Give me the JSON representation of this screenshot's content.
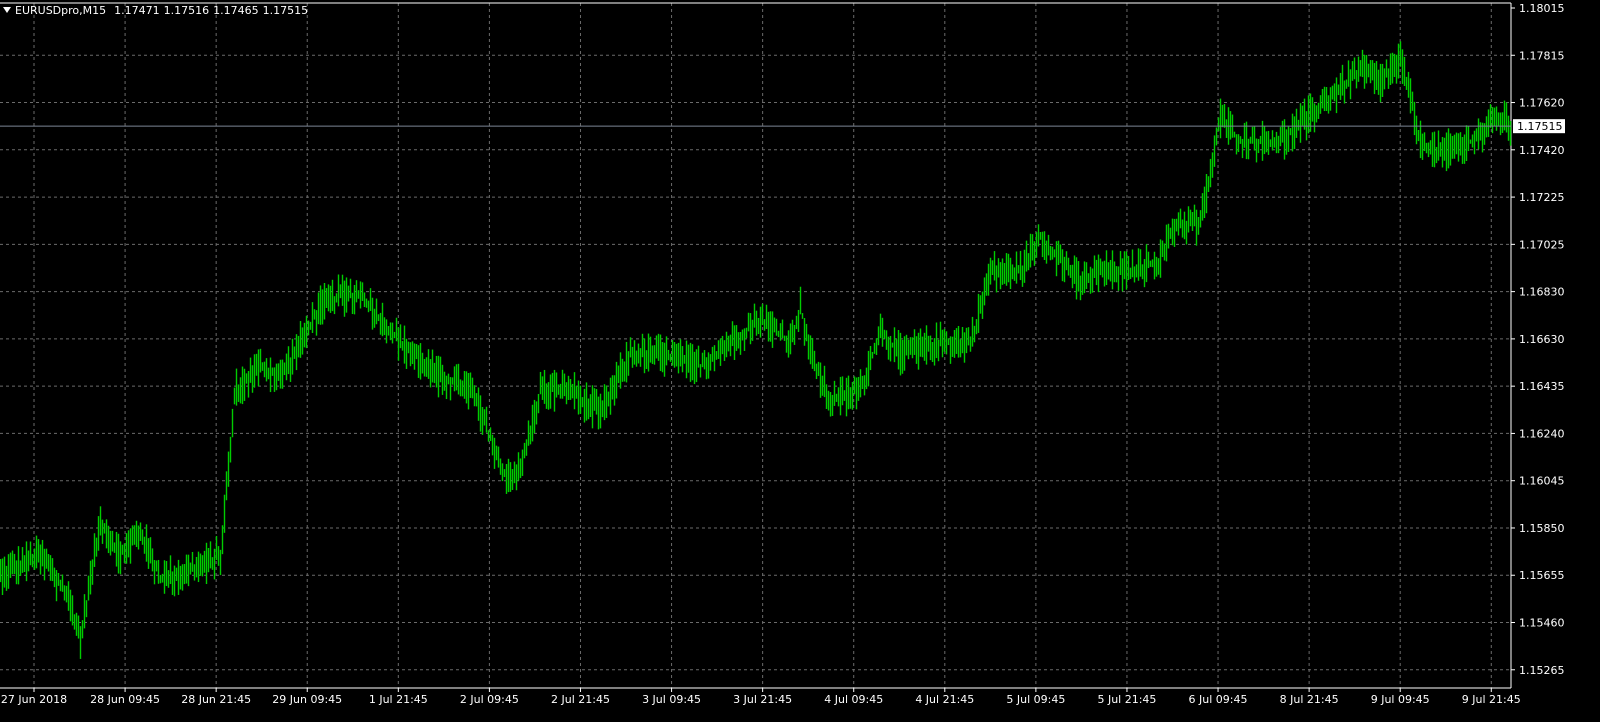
{
  "header": {
    "symbol": "EURUSDpro,M15",
    "open": "1.17471",
    "high": "1.17516",
    "low": "1.17465",
    "close": "1.17515"
  },
  "colors": {
    "background": "#000000",
    "candle": "#00cc00",
    "grid": "#6b6b6b",
    "axis_text": "#ffffff",
    "bid_line": "#7d8796"
  },
  "chart_data": {
    "type": "line",
    "title": "",
    "xlabel": "",
    "ylabel": "",
    "ylim": [
      1.1512,
      1.1802
    ],
    "yticks": [
      "1.18015",
      "1.17815",
      "1.17620",
      "1.17420",
      "1.17225",
      "1.17025",
      "1.16830",
      "1.16630",
      "1.16435",
      "1.16240",
      "1.16045",
      "1.15850",
      "1.15655",
      "1.15460",
      "1.15265"
    ],
    "xticks": [
      "27 Jun 2018",
      "28 Jun 09:45",
      "28 Jun 21:45",
      "29 Jun 09:45",
      "1 Jul 21:45",
      "2 Jul 09:45",
      "2 Jul 21:45",
      "3 Jul 09:45",
      "3 Jul 21:45",
      "4 Jul 09:45",
      "4 Jul 21:45",
      "5 Jul 09:45",
      "5 Jul 21:45",
      "6 Jul 09:45",
      "8 Jul 21:45",
      "9 Jul 09:45",
      "9 Jul 21:45"
    ],
    "current_price": "1.17515",
    "series": [
      {
        "x": [
          0,
          40,
          70,
          80,
          100,
          120,
          140,
          160,
          200,
          220,
          235,
          260,
          280,
          320,
          340,
          360,
          380,
          400,
          440,
          470,
          490,
          500,
          520,
          540,
          570,
          600,
          630,
          660,
          700,
          730,
          760,
          790,
          800,
          810,
          830,
          860,
          880,
          900,
          940,
          970,
          990,
          1020,
          1040,
          1060,
          1080,
          1100,
          1130,
          1160,
          1175,
          1200,
          1220,
          1240,
          1280,
          1320,
          1360,
          1380,
          1400,
          1420,
          1440,
          1470,
          1500,
          1510
        ],
        "close": [
          1.1562,
          1.157,
          1.155,
          1.1535,
          1.1585,
          1.157,
          1.158,
          1.156,
          1.1565,
          1.157,
          1.164,
          1.165,
          1.1645,
          1.1675,
          1.168,
          1.168,
          1.167,
          1.166,
          1.1645,
          1.164,
          1.162,
          1.1605,
          1.1605,
          1.164,
          1.164,
          1.163,
          1.1655,
          1.1655,
          1.165,
          1.166,
          1.167,
          1.166,
          1.1675,
          1.1655,
          1.1635,
          1.164,
          1.1665,
          1.1655,
          1.166,
          1.166,
          1.169,
          1.169,
          1.1705,
          1.1695,
          1.1685,
          1.169,
          1.169,
          1.1695,
          1.171,
          1.171,
          1.1755,
          1.1745,
          1.1745,
          1.176,
          1.1775,
          1.177,
          1.178,
          1.1745,
          1.174,
          1.1745,
          1.1755,
          1.1751
        ]
      }
    ]
  }
}
